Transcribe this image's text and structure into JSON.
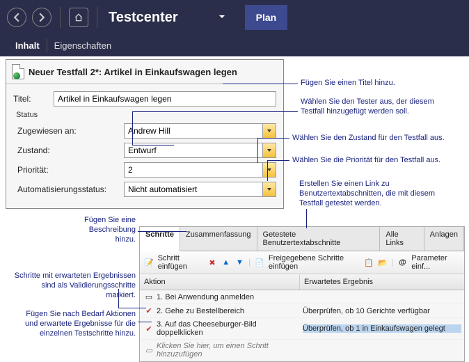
{
  "header": {
    "app_title": "Testcenter",
    "plan_tab": "Plan"
  },
  "subtabs": {
    "inhalt": "Inhalt",
    "eigenschaften": "Eigenschaften"
  },
  "doc": {
    "title": "Neuer Testfall 2*: Artikel in Einkaufswagen legen",
    "titel_label": "Titel:",
    "titel_value": "Artikel in Einkaufswagen legen",
    "status_label": "Status",
    "assigned_label": "Zugewiesen an:",
    "assigned_value": "Andrew Hill",
    "state_label": "Zustand:",
    "state_value": "Entwurf",
    "priority_label": "Priorität:",
    "priority_value": "2",
    "auto_label": "Automatisierungsstatus:",
    "auto_value": "Nicht automatisiert"
  },
  "lower_tabs": {
    "schritte": "Schritte",
    "zusammenfassung": "Zusammenfassung",
    "benutzertext": "Getestete Benutzertextabschnitte",
    "links": "Alle Links",
    "anlagen": "Anlagen"
  },
  "toolbar": {
    "insert_step": "Schritt einfügen",
    "insert_shared": "Freigegebene Schritte einfügen",
    "param": "Parameter einf..."
  },
  "grid": {
    "col_action": "Aktion",
    "col_expected": "Erwartetes Ergebnis",
    "rows": [
      {
        "n": "1.",
        "action": "Bei Anwendung anmelden",
        "expected": ""
      },
      {
        "n": "2.",
        "action": "Gehe zu Bestellbereich",
        "expected": "Überprüfen, ob 10 Gerichte verfügbar"
      },
      {
        "n": "3.",
        "action": "Auf das Cheeseburger-Bild doppelklicken",
        "expected": "Überprüfen, ob 1 in Einkaufswagen gelegt"
      }
    ],
    "placeholder": "Klicken Sie hier, um einen Schritt hinzuzufügen"
  },
  "callouts": {
    "title": "Fügen Sie einen Titel hinzu.",
    "tester": "Wählen Sie den Tester aus, der diesem Testfall hinzugefügt werden soll.",
    "state": "Wählen Sie den Zustand für den Testfall aus.",
    "priority": "Wählen Sie die Priorität für den Testfall aus.",
    "link_user": "Erstellen Sie einen Link zu Benutzertextabschnitten, die mit diesem Testfall getestet werden.",
    "description": "Fügen Sie eine Beschreibung hinzu.",
    "validation": "Schritte mit erwarteten Ergebnissen sind als Validierungsschritte markiert.",
    "add_steps": "Fügen Sie nach Bedarf Aktionen und erwartete Ergebnisse für die einzelnen Testschritte hinzu."
  }
}
